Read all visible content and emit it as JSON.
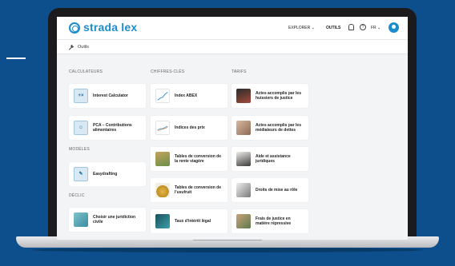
{
  "header": {
    "brand": "strada lex",
    "nav_explorer": "EXPLORER ⌄",
    "nav_outils": "OUTILS",
    "lang": "FR ⌄",
    "help_symbol": "?"
  },
  "breadcrumb": {
    "label": "Outils"
  },
  "columns": {
    "calculateurs": {
      "title": "CALCULATEURS",
      "items": [
        {
          "label": "Interest Calculator",
          "icon": "calculator-icon"
        },
        {
          "label": "PCA – Contributions alimentaires",
          "icon": "family-icon"
        }
      ]
    },
    "modeles": {
      "title": "MODÈLES",
      "items": [
        {
          "label": "Easydrafting",
          "icon": "document-icon"
        }
      ]
    },
    "declic": {
      "title": "DÉCLIC",
      "items": [
        {
          "label": "Choisir une juridiction civile",
          "icon": "person-photo"
        }
      ]
    },
    "chiffres": {
      "title": "CHIFFRES-CLÉS",
      "items": [
        {
          "label": "Index ABEX",
          "icon": "line-chart-icon"
        },
        {
          "label": "Indices des prix",
          "icon": "multi-line-chart-icon"
        },
        {
          "label": "Tables de conversion de la rente viagère",
          "icon": "money-photo"
        },
        {
          "label": "Tables de conversion de l'usufruit",
          "icon": "coins-photo"
        },
        {
          "label": "Taux d'intérêt légal",
          "icon": "interest-photo"
        }
      ]
    },
    "tarifs": {
      "title": "TARIFS",
      "items": [
        {
          "label": "Actes accomplis par les huissiers de justice",
          "icon": "bailiff-photo"
        },
        {
          "label": "Actes accomplis par les médiateurs de dettes",
          "icon": "handshake-photo"
        },
        {
          "label": "Aide et assistance juridiques",
          "icon": "lawyer-photo"
        },
        {
          "label": "Droits de mise au rôle",
          "icon": "gavel-photo"
        },
        {
          "label": "Frais de justice en matière répressive",
          "icon": "court-photo"
        }
      ]
    }
  },
  "colors": {
    "brand": "#1c8ccd",
    "background": "#0d4f8c",
    "screen_bg": "#f3f4f6"
  }
}
